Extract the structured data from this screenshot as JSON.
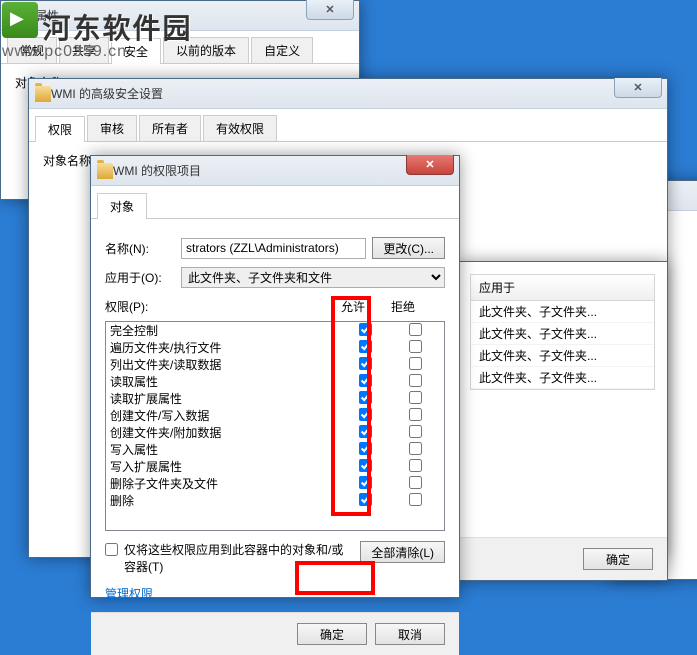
{
  "watermark": {
    "text": "河东软件园",
    "url": "www.pc0359.cn"
  },
  "win1": {
    "title": "WMI 属性",
    "tabs": [
      "常规",
      "共享",
      "安全",
      "以前的版本",
      "自定义"
    ],
    "objlabel": "对象名称:"
  },
  "win2": {
    "title": "WMI 的高级安全设置",
    "tabs": [
      "权限",
      "审核",
      "所有者",
      "有效权限"
    ],
    "objlabel": "对象名称:"
  },
  "winback": {
    "header": "应用于",
    "rows": [
      "此文件夹、子文件夹...",
      "此文件夹、子文件夹...",
      "此文件夹、子文件夹...",
      "此文件夹、子文件夹..."
    ],
    "ok": "确定"
  },
  "win3": {
    "title": "WMI 的权限项目",
    "tab": "对象",
    "name_label": "名称(N):",
    "name_value": "strators (ZZL\\Administrators)",
    "change_btn": "更改(C)...",
    "apply_label": "应用于(O):",
    "apply_value": "此文件夹、子文件夹和文件",
    "perm_label": "权限(P):",
    "col_allow": "允许",
    "col_deny": "拒绝",
    "perms": [
      {
        "label": "完全控制",
        "allow": true,
        "deny": false
      },
      {
        "label": "遍历文件夹/执行文件",
        "allow": true,
        "deny": false
      },
      {
        "label": "列出文件夹/读取数据",
        "allow": true,
        "deny": false
      },
      {
        "label": "读取属性",
        "allow": true,
        "deny": false
      },
      {
        "label": "读取扩展属性",
        "allow": true,
        "deny": false
      },
      {
        "label": "创建文件/写入数据",
        "allow": true,
        "deny": false
      },
      {
        "label": "创建文件夹/附加数据",
        "allow": true,
        "deny": false
      },
      {
        "label": "写入属性",
        "allow": true,
        "deny": false
      },
      {
        "label": "写入扩展属性",
        "allow": true,
        "deny": false
      },
      {
        "label": "删除子文件夹及文件",
        "allow": true,
        "deny": false
      },
      {
        "label": "删除",
        "allow": true,
        "deny": false
      }
    ],
    "only_label": "仅将这些权限应用到此容器中的对象和/或容器(T)",
    "clear_btn": "全部清除(L)",
    "manage_link": "管理权限",
    "ok": "确定",
    "cancel": "取消"
  }
}
